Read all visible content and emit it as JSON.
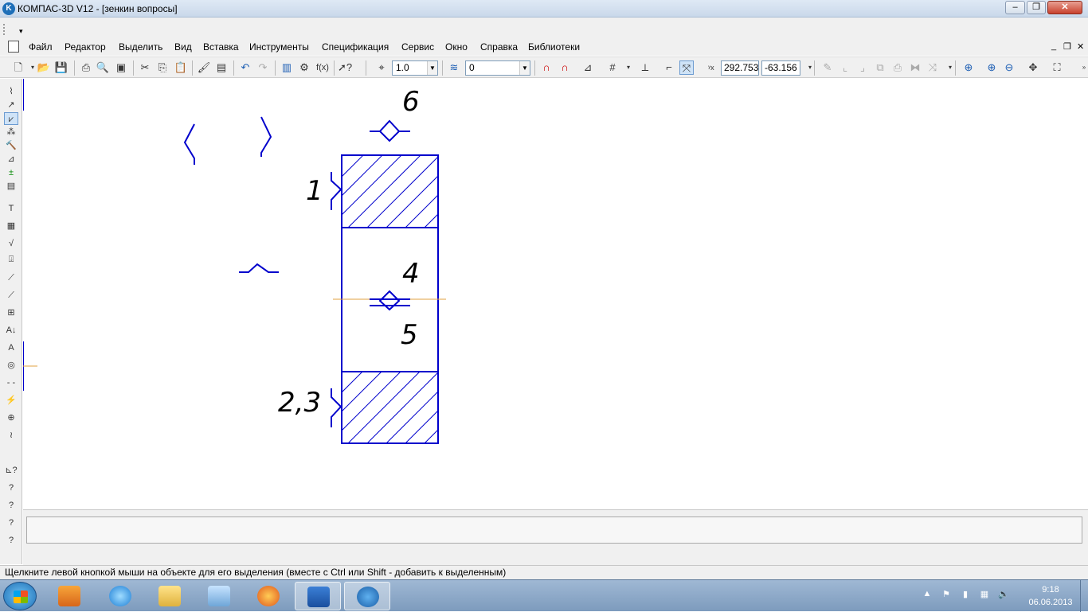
{
  "window": {
    "title": "КОМПАС-3D V12 - [зенкин вопросы]",
    "app_icon_letter": "K"
  },
  "menu": {
    "items": [
      "Файл",
      "Редактор",
      "Выделить",
      "Вид",
      "Вставка",
      "Инструменты",
      "Спецификация",
      "Сервис",
      "Окно",
      "Справка",
      "Библиотеки"
    ]
  },
  "toolbar": {
    "step": "1.0",
    "layer": "0",
    "coord_x": "292.753",
    "coord_y": "-63.156"
  },
  "drawing": {
    "labels": [
      "6",
      "1",
      "4",
      "5",
      "2,3"
    ],
    "line_color": "#0000cc",
    "axis_color": "#e0a040"
  },
  "status_text": "Щелкните левой кнопкой мыши на объекте для его выделения (вместе с Ctrl или Shift - добавить к выделенным)",
  "taskbar": {
    "time": "9:18",
    "date": "06.06.2013"
  }
}
